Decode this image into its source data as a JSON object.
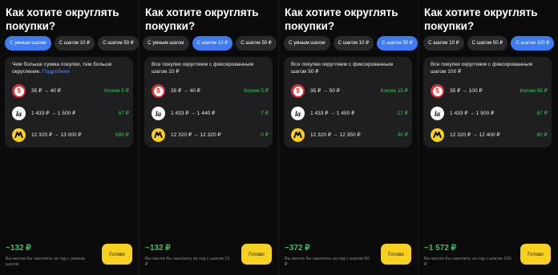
{
  "screens": [
    {
      "title": "Как хотите округлять покупки?",
      "chips": [
        {
          "label": "С умным шагом",
          "active": true
        },
        {
          "label": "С шагом 10 ₽",
          "active": false
        },
        {
          "label": "С шагом 50 ₽",
          "active": false
        }
      ],
      "description": "Чем больше сумма покупки, тем больше округление.",
      "more_link": "Подробнее",
      "rows": [
        {
          "logo": "five-icon",
          "amount": "35 ₽ → 40 ₽",
          "save": "Копим 5 ₽"
        },
        {
          "logo": "la-icon",
          "amount": "1 433 ₽ → 1 500 ₽",
          "save": "67 ₽"
        },
        {
          "logo": "ym-icon",
          "amount": "12 320 ₽ → 13 000 ₽",
          "save": "680 ₽"
        }
      ],
      "total": "~132 ₽",
      "note": "Вы могли бы накопить за год с умным шагом",
      "done_label": "Готово"
    },
    {
      "title": "Как хотите округлять покупки?",
      "chips": [
        {
          "label": "С умным шагом",
          "active": false
        },
        {
          "label": "С шагом 10 ₽",
          "active": true
        },
        {
          "label": "С шагом 50 ₽",
          "active": false
        }
      ],
      "description": "Все покупки округляем с фиксированным шагом 10 ₽",
      "more_link": "",
      "rows": [
        {
          "logo": "five-icon",
          "amount": "35 ₽ → 40 ₽",
          "save": "Копим 5 ₽"
        },
        {
          "logo": "la-icon",
          "amount": "1 433 ₽ → 1 440 ₽",
          "save": "7 ₽"
        },
        {
          "logo": "ym-icon",
          "amount": "12 320 ₽ → 12 320 ₽",
          "save": "0 ₽"
        }
      ],
      "total": "~132 ₽",
      "note": "Вы могли бы накопить за год с шагом 10 ₽",
      "done_label": "Готово"
    },
    {
      "title": "Как хотите округлять покупки?",
      "chips": [
        {
          "label": "С умным шагом",
          "active": false
        },
        {
          "label": "С шагом 10 ₽",
          "active": false
        },
        {
          "label": "С шагом 50 ₽",
          "active": true
        }
      ],
      "description": "Все покупки округляем с фиксированным шагом 50 ₽",
      "more_link": "",
      "rows": [
        {
          "logo": "five-icon",
          "amount": "35 ₽ → 50 ₽",
          "save": "Копим 15 ₽"
        },
        {
          "logo": "la-icon",
          "amount": "1 433 ₽ → 1 450 ₽",
          "save": "17 ₽"
        },
        {
          "logo": "ym-icon",
          "amount": "12 320 ₽ → 12 350 ₽",
          "save": "30 ₽"
        }
      ],
      "total": "~372 ₽",
      "note": "Вы могли бы накопить за год с шагом 50 ₽",
      "done_label": "Готово"
    },
    {
      "title": "Как хотите округлять покупки?",
      "chips": [
        {
          "label": "С шагом 10 ₽",
          "active": false
        },
        {
          "label": "С шагом 50 ₽",
          "active": false
        },
        {
          "label": "С шагом 100 ₽",
          "active": true
        }
      ],
      "description": "Все покупки округляем с фиксированным шагом 100 ₽",
      "more_link": "",
      "rows": [
        {
          "logo": "five-icon",
          "amount": "35 ₽ → 100 ₽",
          "save": "Копим 65 ₽"
        },
        {
          "logo": "la-icon",
          "amount": "1 433 ₽ → 1 500 ₽",
          "save": "67 ₽"
        },
        {
          "logo": "ym-icon",
          "amount": "12 320 ₽ → 12 400 ₽",
          "save": "80 ₽"
        }
      ],
      "total": "~1 572 ₽",
      "note": "Вы могли бы накопить за год с шагом 100 ₽",
      "done_label": "Готово"
    }
  ]
}
